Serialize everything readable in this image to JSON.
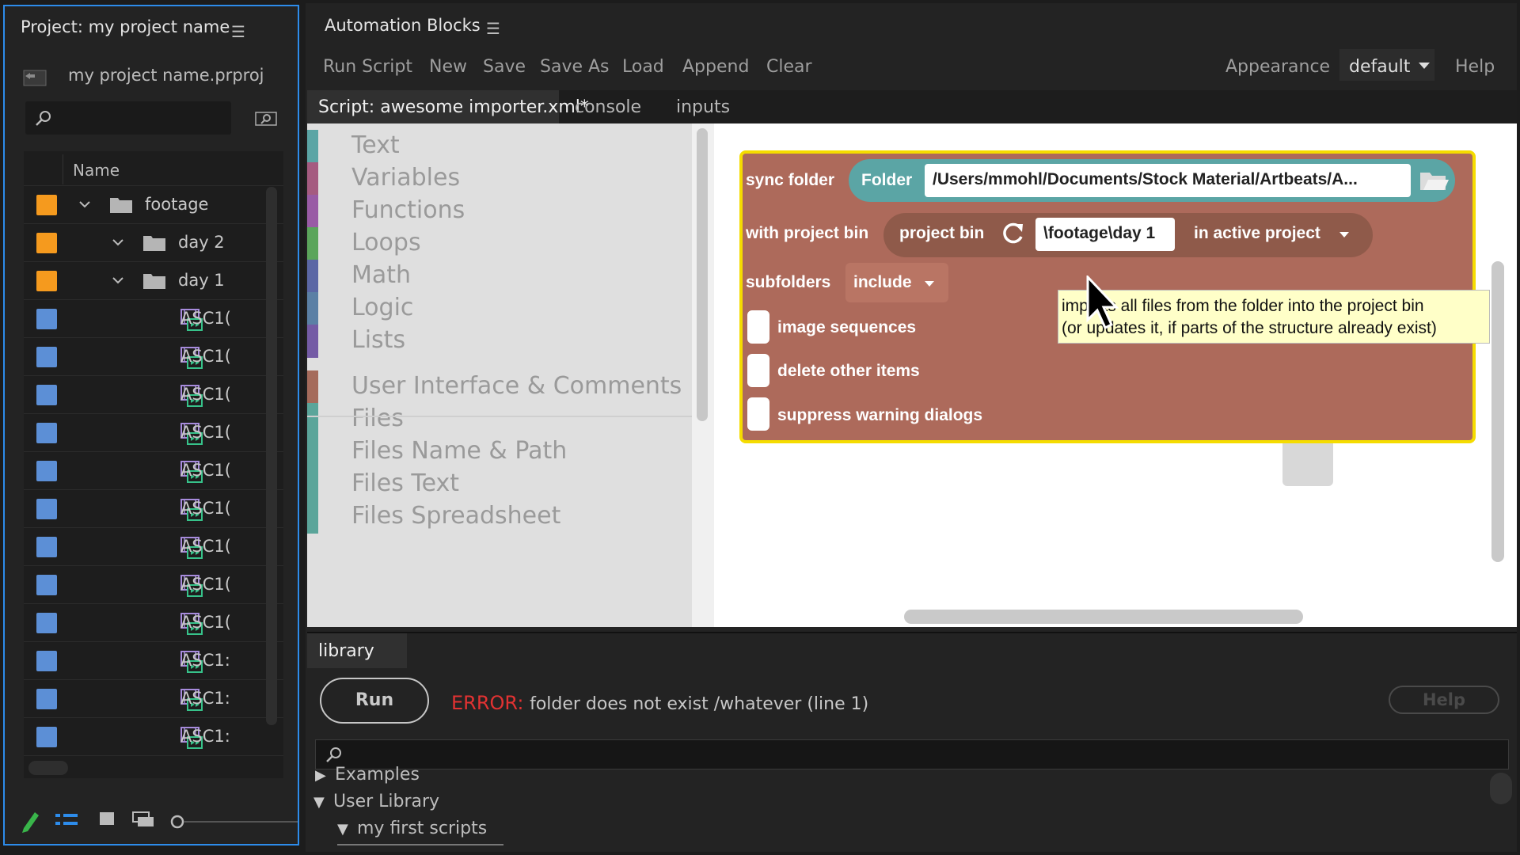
{
  "project_panel": {
    "title": "Project: my project name",
    "project_file": "my project name.prproj",
    "column_header": "Name",
    "rows": [
      {
        "label": "footage",
        "kind": "folder",
        "indent": 0,
        "color": "#f59a1e"
      },
      {
        "label": "day 2",
        "kind": "folder",
        "indent": 1,
        "color": "#f59a1e"
      },
      {
        "label": "day 1",
        "kind": "folder",
        "indent": 1,
        "color": "#f59a1e"
      },
      {
        "label": "ASC1(",
        "kind": "clip",
        "color": "#5c8fd6"
      },
      {
        "label": "ASC1(",
        "kind": "clip",
        "color": "#5c8fd6"
      },
      {
        "label": "ASC1(",
        "kind": "clip",
        "color": "#5c8fd6"
      },
      {
        "label": "ASC1(",
        "kind": "clip",
        "color": "#5c8fd6"
      },
      {
        "label": "ASC1(",
        "kind": "clip",
        "color": "#5c8fd6"
      },
      {
        "label": "ASC1(",
        "kind": "clip",
        "color": "#5c8fd6"
      },
      {
        "label": "ASC1(",
        "kind": "clip",
        "color": "#5c8fd6"
      },
      {
        "label": "ASC1(",
        "kind": "clip",
        "color": "#5c8fd6"
      },
      {
        "label": "ASC1(",
        "kind": "clip",
        "color": "#5c8fd6"
      },
      {
        "label": "ASC1:",
        "kind": "clip",
        "color": "#5c8fd6"
      },
      {
        "label": "ASC1:",
        "kind": "clip",
        "color": "#5c8fd6"
      },
      {
        "label": "ASC1:",
        "kind": "clip",
        "color": "#5c8fd6"
      }
    ]
  },
  "automation_panel": {
    "title": "Automation Blocks",
    "menu": [
      "Run Script",
      "New",
      "Save",
      "Save As",
      "Load",
      "Append",
      "Clear"
    ],
    "appearance_label": "Appearance",
    "appearance_value": "default",
    "help_label": "Help",
    "tabs": [
      "Script: awesome importer.xml*",
      "console",
      "inputs"
    ],
    "toolbox": [
      {
        "label": "Text",
        "color": "#5ba5a5"
      },
      {
        "label": "Variables",
        "color": "#a55b80"
      },
      {
        "label": "Functions",
        "color": "#995ba5"
      },
      {
        "label": "Loops",
        "color": "#5ba55b"
      },
      {
        "label": "Math",
        "color": "#5b67a5"
      },
      {
        "label": "Logic",
        "color": "#5b80a5"
      },
      {
        "label": "Lists",
        "color": "#745ba5"
      },
      {
        "label": "User Interface & Comments",
        "color": "#a56b5b"
      },
      {
        "label": "Files",
        "color": "#5ba59a"
      },
      {
        "label": "Files Name & Path",
        "color": "#5ba59a"
      },
      {
        "label": "Files Text",
        "color": "#5ba59a"
      },
      {
        "label": "Files Spreadsheet",
        "color": "#5ba59a"
      }
    ],
    "block": {
      "sync_folder_label": "sync folder",
      "folder_label": "Folder",
      "folder_path": "/Users/mmohl/Documents/Stock Material/Artbeats/A...",
      "with_project_bin_label": "with project bin",
      "project_bin_label": "project bin",
      "bin_path": "\\footage\\day 1",
      "in_active_project_label": "in active project",
      "subfolders_label": "subfolders",
      "subfolders_value": "include",
      "option_image_sequences": "image sequences",
      "option_delete_other_items": "delete other items",
      "option_suppress_warning_dialogs": "suppress warning dialogs"
    },
    "tooltip": {
      "line1": "imports all files from the folder into the project bin",
      "line2": "(or updates it, if parts of the structure already exist)"
    },
    "library_tab": "library",
    "run_button": "Run",
    "error_key": "ERROR:",
    "error_message": "folder does not exist /whatever (line 1)",
    "bottom_help_button": "Help",
    "library_tree": [
      {
        "label": "Examples",
        "expanded": false,
        "level": 0
      },
      {
        "label": "User Library",
        "expanded": true,
        "level": 0
      },
      {
        "label": "my first scripts",
        "expanded": true,
        "level": 1
      }
    ]
  },
  "colors": {
    "panel_focus_border": "#2d8ceb",
    "block_body": "#ad6a5b",
    "block_highlight": "#f5dc00",
    "folder_pill": "#5ba5a5",
    "bin_pill": "#8f5a4a",
    "error_red": "#e23232"
  }
}
